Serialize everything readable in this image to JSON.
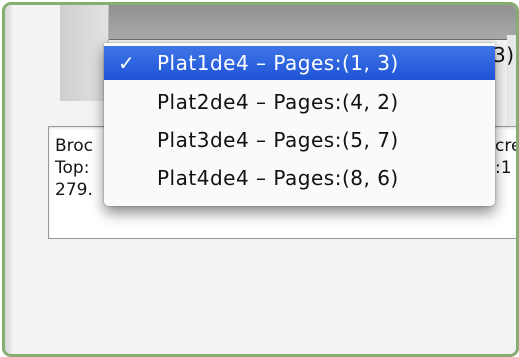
{
  "popup": {
    "current_value_fragment": "3)"
  },
  "text_area": {
    "left_lines": [
      "Broc",
      "Top:",
      "279."
    ],
    "right_lines": [
      "cre",
      ":1"
    ]
  },
  "menu": {
    "check_mark": "✓",
    "items": [
      {
        "label": "Plat1de4 – Pages:(1, 3)",
        "selected": true
      },
      {
        "label": "Plat2de4 – Pages:(4, 2)",
        "selected": false
      },
      {
        "label": "Plat3de4 – Pages:(5, 7)",
        "selected": false
      },
      {
        "label": "Plat4de4 – Pages:(8, 6)",
        "selected": false
      }
    ]
  },
  "colors": {
    "frame_border": "#86ad73",
    "selection": "#2a5fde"
  }
}
